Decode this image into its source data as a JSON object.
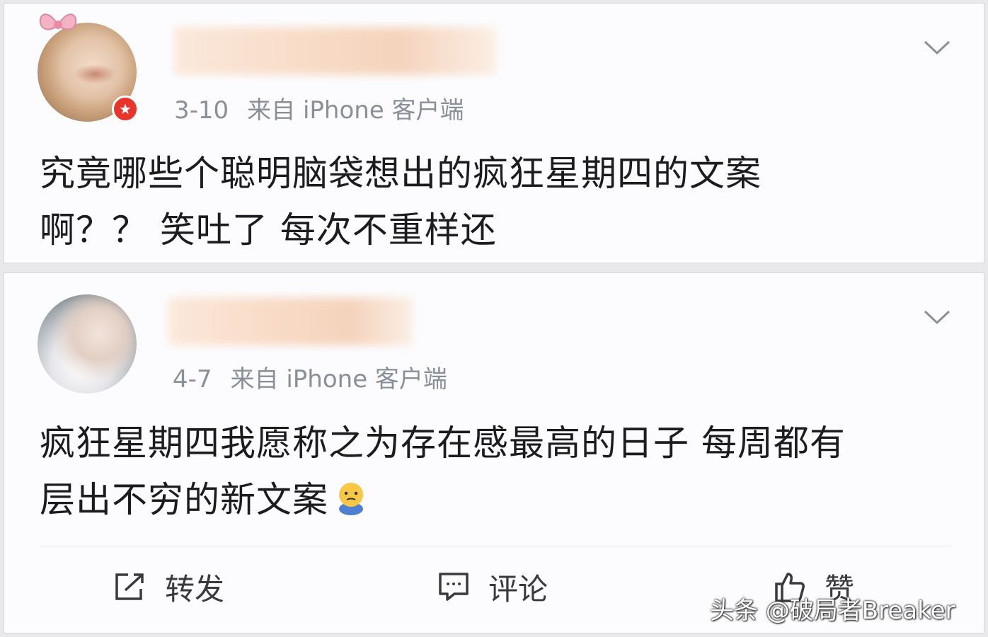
{
  "posts": [
    {
      "date": "3-10",
      "source": "来自 iPhone 客户端",
      "body_lines": [
        "究竟哪些个聪明脑袋想出的疯狂星期四的文案",
        "啊？？ 笑吐了 每次不重样还"
      ]
    },
    {
      "date": "4-7",
      "source": "来自 iPhone 客户端",
      "body_lines": [
        "疯狂星期四我愿称之为存在感最高的日子 每周都有",
        "层出不穷的新文案"
      ]
    }
  ],
  "actions": {
    "repost": "转发",
    "comment": "评论",
    "like": "赞"
  },
  "watermark": "头条 @破局者Breaker",
  "icons": {
    "menu": "chevron-down-icon",
    "repost": "share-icon",
    "comment": "comment-icon",
    "like": "thumbs-up-icon",
    "verified": "verified-badge-icon",
    "emoji": "emoji-icon"
  }
}
